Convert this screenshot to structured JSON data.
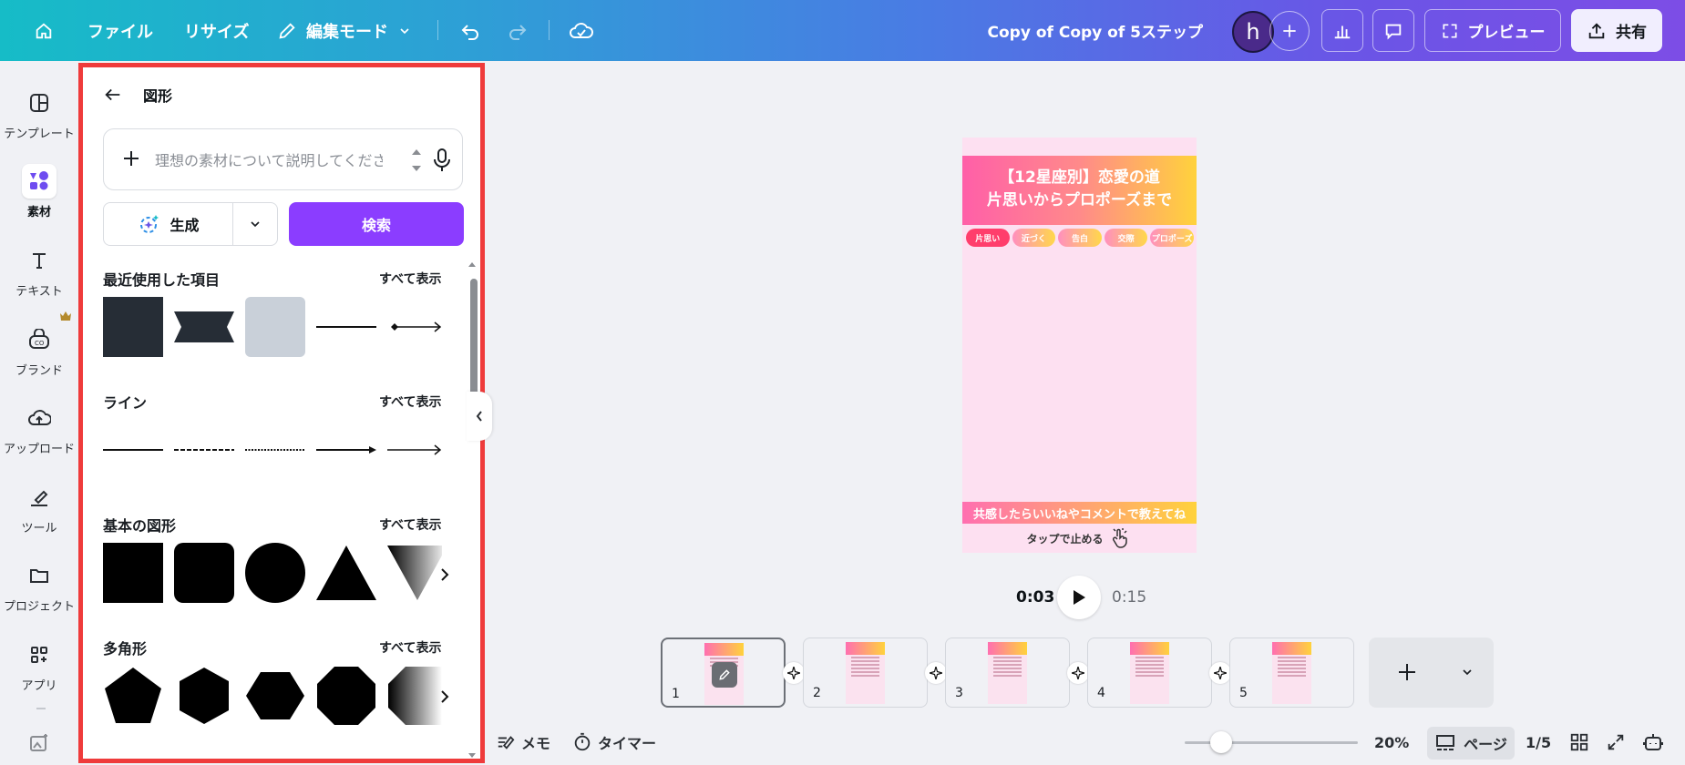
{
  "topbar": {
    "file": "ファイル",
    "resize": "リサイズ",
    "edit_mode": "編集モード",
    "doc_title": "Copy of Copy of 5ステップ",
    "avatar_initial": "h",
    "preview": "プレビュー",
    "share": "共有"
  },
  "rail": {
    "items": [
      {
        "label": "テンプレート"
      },
      {
        "label": "素材"
      },
      {
        "label": "テキスト"
      },
      {
        "label": "ブランド"
      },
      {
        "label": "アップロード"
      },
      {
        "label": "ツール"
      },
      {
        "label": "プロジェクト"
      },
      {
        "label": "アプリ"
      }
    ]
  },
  "panel": {
    "title": "図形",
    "search_placeholder": "理想の素材について説明してください",
    "generate": "生成",
    "search": "検索",
    "see_all": "すべて表示",
    "sections": {
      "recent": "最近使用した項目",
      "lines": "ライン",
      "basic": "基本の図形",
      "polygons": "多角形"
    }
  },
  "canvas": {
    "header_line1": "【12星座別】恋愛の道",
    "header_line2": "片思いからプロポーズまで",
    "steps": [
      "片思い",
      "近づく",
      "告白",
      "交際",
      "プロポーズ"
    ],
    "footer": "共感したらいいねやコメントで教えてね",
    "tap_stop": "タップで止める"
  },
  "player": {
    "current": "0:03",
    "total": "0:15"
  },
  "pages": {
    "numbers": [
      "1",
      "2",
      "3",
      "4",
      "5"
    ]
  },
  "bottombar": {
    "notes": "メモ",
    "timer": "タイマー",
    "zoom": "20%",
    "zoom_fraction": 0.2,
    "pages": "ページ",
    "page_count": "1/5"
  },
  "colors": {
    "accent": "#8b3dff",
    "panel_highlight": "#ef3b3b"
  }
}
